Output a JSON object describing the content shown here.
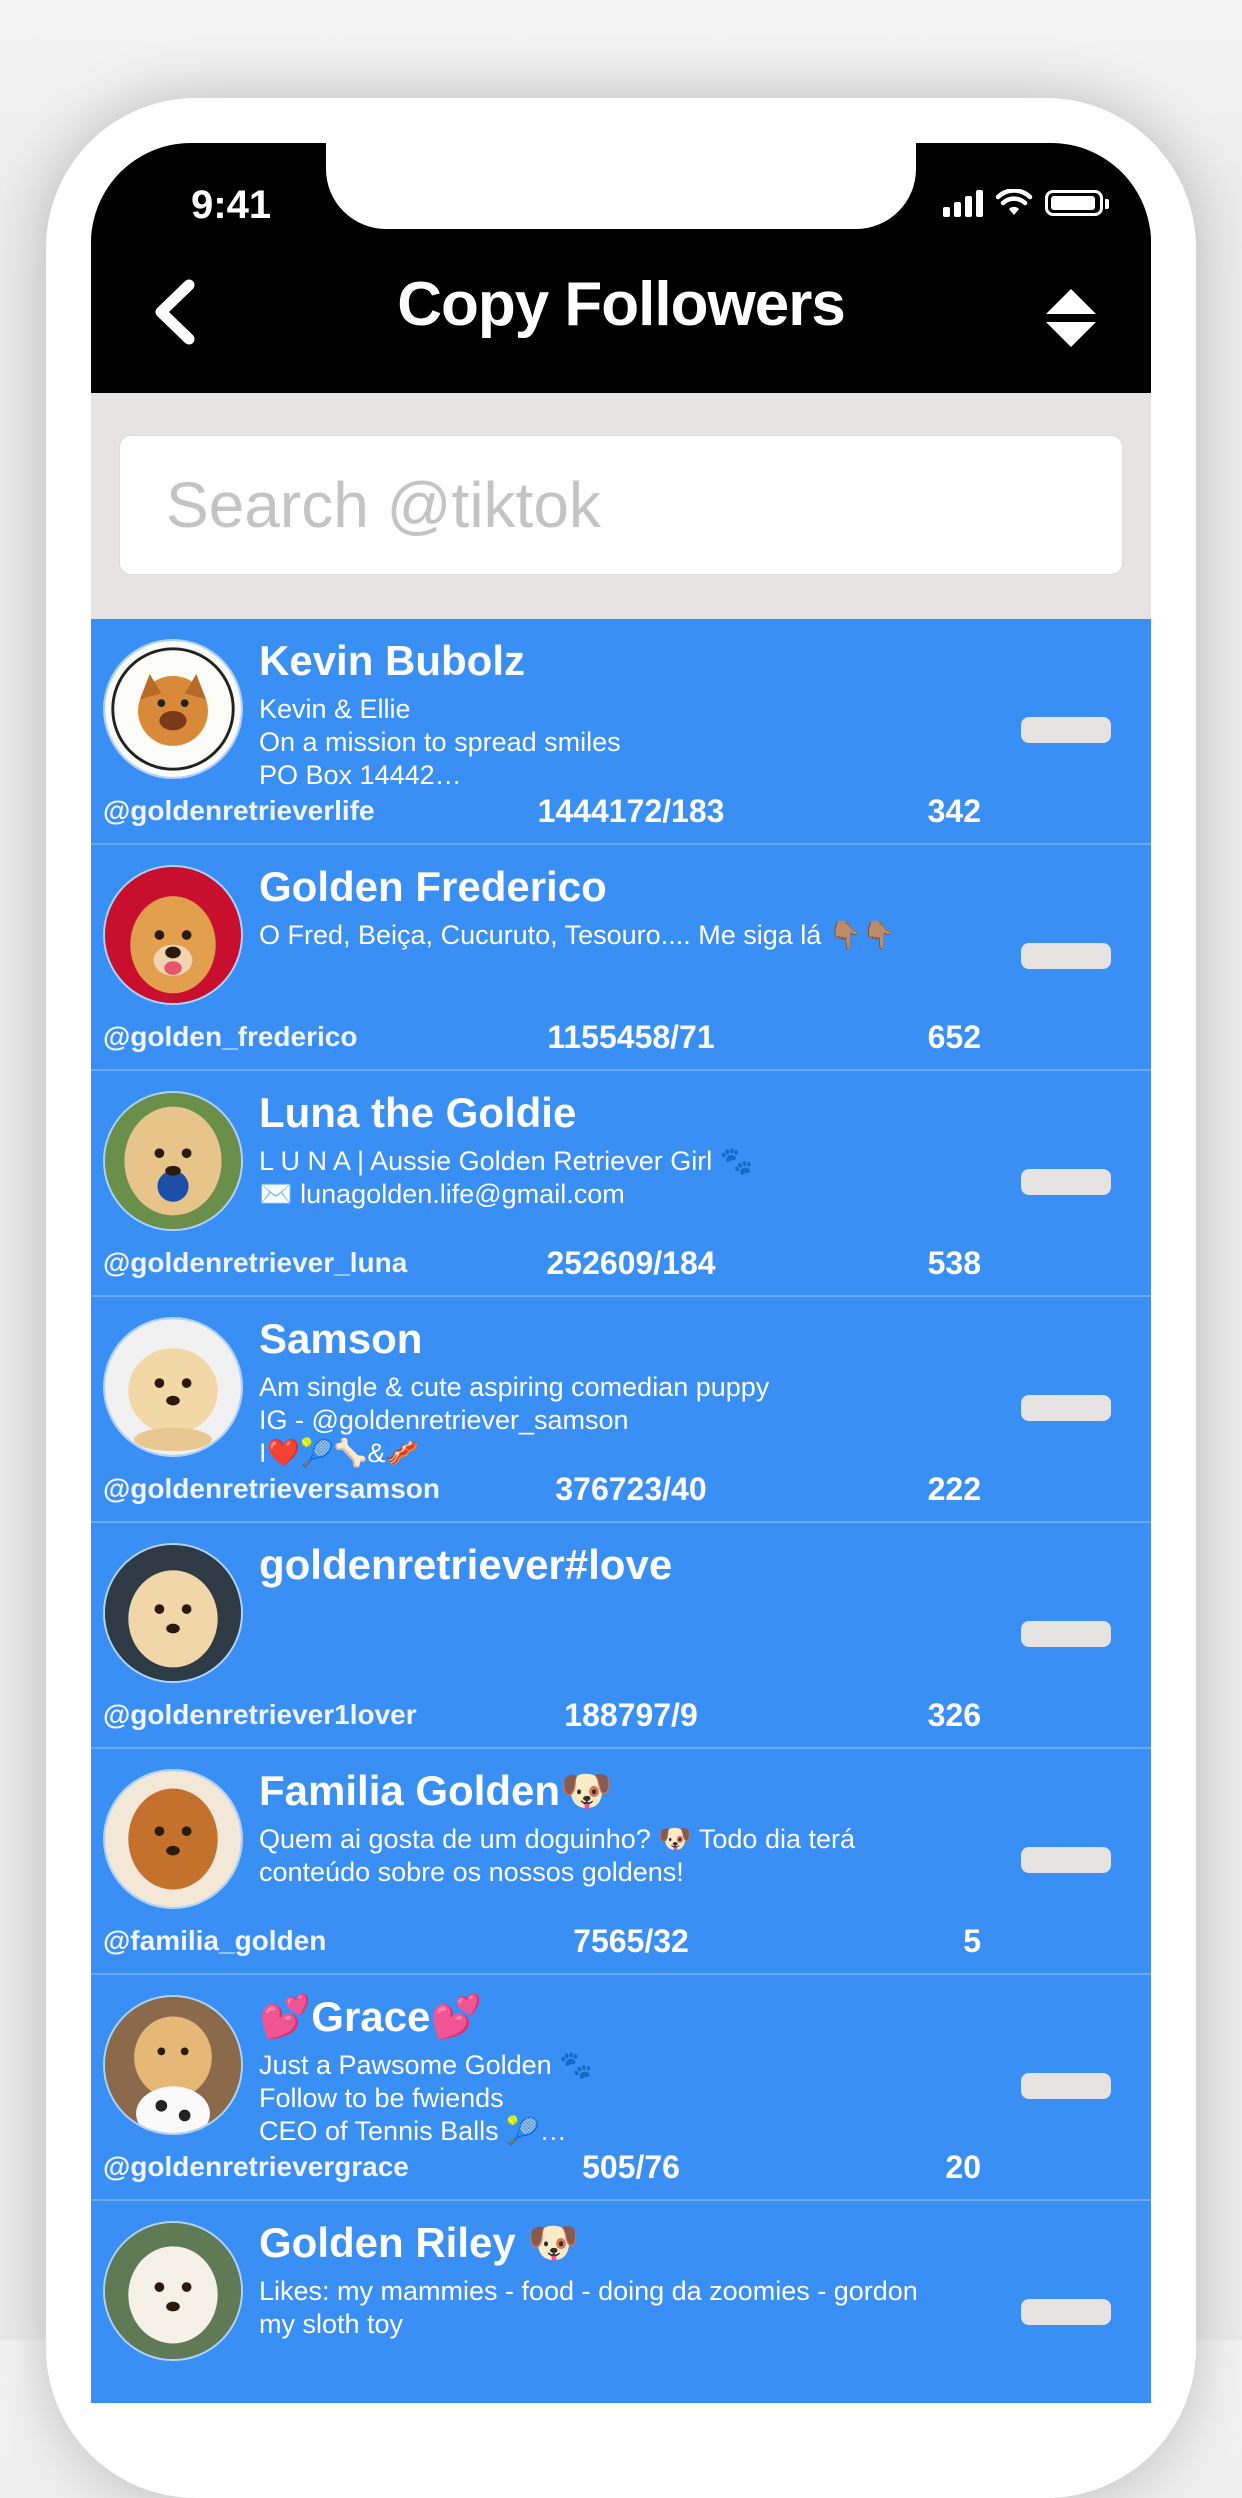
{
  "status_bar": {
    "time": "9:41"
  },
  "navbar": {
    "title": "Copy Followers"
  },
  "search": {
    "placeholder": "Search @tiktok",
    "value": ""
  },
  "accent_color": "#3a8ff4",
  "rows": [
    {
      "name": "Kevin Bubolz",
      "bio": "Kevin & Ellie\nOn a mission to spread smiles\nPO Box 14442…",
      "handle": "@goldenretrieverlife",
      "ratio": "1444172/183",
      "count": "342"
    },
    {
      "name": "Golden Frederico",
      "bio": "O Fred, Beiça, Cucuruto, Tesouro....  Me siga lá 👇🏽👇🏽",
      "handle": "@golden_frederico",
      "ratio": "1155458/71",
      "count": "652"
    },
    {
      "name": "Luna the Goldie",
      "bio": "L U N A | Aussie Golden Retriever Girl 🐾\n✉️ lunagolden.life@gmail.com",
      "handle": "@goldenretriever_luna",
      "ratio": "252609/184",
      "count": "538"
    },
    {
      "name": "Samson",
      "bio": "Am single & cute aspiring comedian puppy\nIG - @goldenretriever_samson\nI❤️🎾🦴&🥓",
      "handle": "@goldenretrieversamson",
      "ratio": "376723/40",
      "count": "222"
    },
    {
      "name": "goldenretriever#love",
      "bio": "",
      "handle": "@goldenretriever1lover",
      "ratio": "188797/9",
      "count": "326"
    },
    {
      "name": "Familia Golden🐶",
      "bio": "Quem ai gosta de um doguinho? 🐶 Todo dia terá\nconteúdo sobre os nossos goldens!",
      "handle": "@familia_golden",
      "ratio": "7565/32",
      "count": "5"
    },
    {
      "name": "💕Grace💕",
      "bio": "Just a Pawsome Golden 🐾\nFollow to be fwiends\nCEO of Tennis Balls 🎾…",
      "handle": "@goldenretrievergrace",
      "ratio": "505/76",
      "count": "20"
    },
    {
      "name": "Golden Riley 🐶",
      "bio": "Likes: my mammies - food - doing da zoomies - gordon\nmy sloth toy",
      "handle": "",
      "ratio": "",
      "count": ""
    }
  ]
}
